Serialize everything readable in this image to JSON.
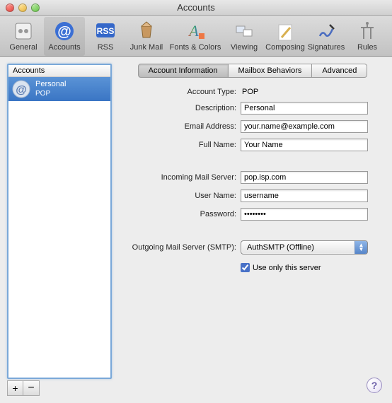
{
  "window": {
    "title": "Accounts"
  },
  "toolbar": [
    {
      "label": "General"
    },
    {
      "label": "Accounts"
    },
    {
      "label": "RSS"
    },
    {
      "label": "Junk Mail"
    },
    {
      "label": "Fonts & Colors"
    },
    {
      "label": "Viewing"
    },
    {
      "label": "Composing"
    },
    {
      "label": "Signatures"
    },
    {
      "label": "Rules"
    }
  ],
  "sidebar": {
    "header": "Accounts",
    "items": [
      {
        "name": "Personal",
        "type": "POP"
      }
    ]
  },
  "tabs": [
    {
      "label": "Account Information"
    },
    {
      "label": "Mailbox Behaviors"
    },
    {
      "label": "Advanced"
    }
  ],
  "form": {
    "account_type_label": "Account Type:",
    "account_type_value": "POP",
    "description_label": "Description:",
    "description_value": "Personal",
    "email_label": "Email Address:",
    "email_value": "your.name@example.com",
    "fullname_label": "Full Name:",
    "fullname_value": "Your Name",
    "incoming_label": "Incoming Mail Server:",
    "incoming_value": "pop.isp.com",
    "username_label": "User Name:",
    "username_value": "username",
    "password_label": "Password:",
    "password_value": "••••••••",
    "outgoing_label": "Outgoing Mail Server (SMTP):",
    "outgoing_value": "AuthSMTP (Offline)",
    "use_only_label": "Use only this server",
    "use_only_checked": true
  },
  "buttons": {
    "add": "+",
    "remove": "−",
    "help": "?"
  }
}
